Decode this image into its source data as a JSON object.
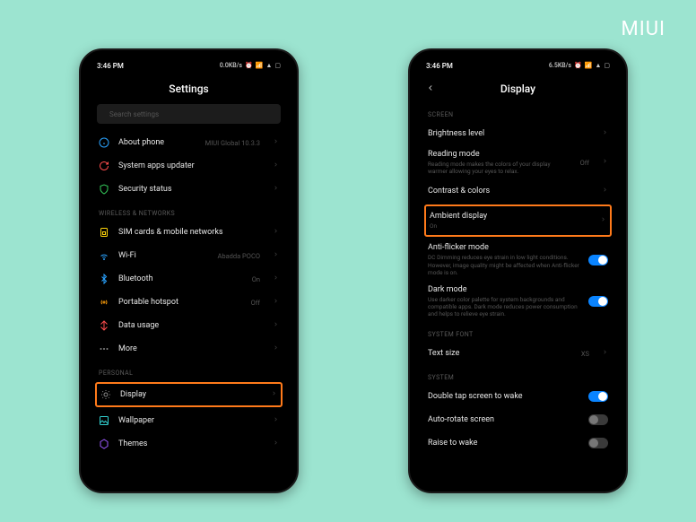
{
  "brand": "MIUI",
  "statusbar": {
    "time": "3:46 PM",
    "net_left": "0.0KB/s",
    "net_right": "6.5KB/s"
  },
  "left": {
    "title": "Settings",
    "search_placeholder": "Search settings",
    "sections": {
      "top": [
        {
          "icon": "info",
          "label": "About phone",
          "value": "MIUI Global 10.3.3"
        },
        {
          "icon": "update",
          "label": "System apps updater",
          "value": ""
        },
        {
          "icon": "shield",
          "label": "Security status",
          "value": ""
        }
      ],
      "wireless_label": "WIRELESS & NETWORKS",
      "wireless": [
        {
          "icon": "sim",
          "label": "SIM cards & mobile networks",
          "value": ""
        },
        {
          "icon": "wifi",
          "label": "Wi-Fi",
          "value": "Abadda POCO"
        },
        {
          "icon": "bluetooth",
          "label": "Bluetooth",
          "value": "On"
        },
        {
          "icon": "hotspot",
          "label": "Portable hotspot",
          "value": "Off"
        },
        {
          "icon": "data",
          "label": "Data usage",
          "value": ""
        },
        {
          "icon": "more",
          "label": "More",
          "value": ""
        }
      ],
      "personal_label": "PERSONAL",
      "personal": [
        {
          "icon": "display",
          "label": "Display",
          "value": "",
          "highlight": true
        },
        {
          "icon": "wallpaper",
          "label": "Wallpaper",
          "value": ""
        },
        {
          "icon": "themes",
          "label": "Themes",
          "value": ""
        }
      ]
    }
  },
  "right": {
    "title": "Display",
    "sections": {
      "screen_label": "SCREEN",
      "screen": [
        {
          "label": "Brightness level",
          "sub": "",
          "right": "chev"
        },
        {
          "label": "Reading mode",
          "sub": "Reading mode makes the colors of your display warmer allowing your eyes to relax.",
          "value": "Off",
          "right": "chev"
        },
        {
          "label": "Contrast & colors",
          "sub": "",
          "right": "chev"
        },
        {
          "label": "Ambient display",
          "sub": "On",
          "right": "chev",
          "highlight": true
        },
        {
          "label": "Anti-flicker mode",
          "sub": "DC Dimming reduces eye strain in low light conditions. However, image quality might be affected when Anti-flicker mode is on.",
          "right": "toggle-on"
        },
        {
          "label": "Dark mode",
          "sub": "Use darker color palette for system backgrounds and compatible apps. Dark mode reduces power consumption and helps to relieve eye strain.",
          "right": "toggle-on"
        }
      ],
      "font_label": "SYSTEM FONT",
      "font": [
        {
          "label": "Text size",
          "value": "XS",
          "right": "chev"
        }
      ],
      "system_label": "SYSTEM",
      "system": [
        {
          "label": "Double tap screen to wake",
          "right": "toggle-on"
        },
        {
          "label": "Auto-rotate screen",
          "right": "toggle-off"
        },
        {
          "label": "Raise to wake",
          "right": "toggle-off"
        }
      ]
    }
  }
}
